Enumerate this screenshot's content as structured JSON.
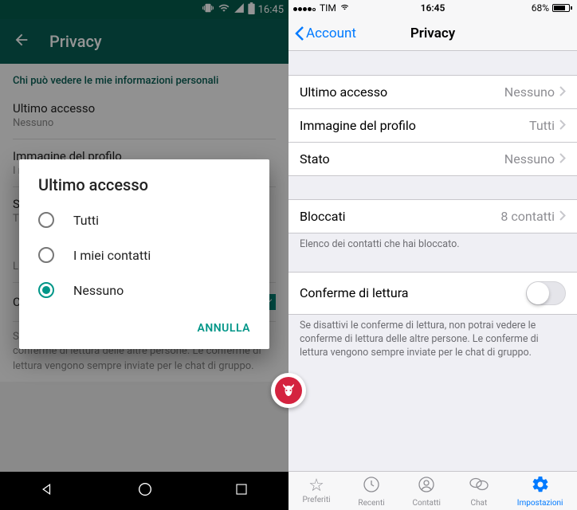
{
  "android": {
    "status": {
      "time": "16:45"
    },
    "toolbar": {
      "title": "Privacy"
    },
    "section_header": "Chi può vedere le mie informazioni personali",
    "items": [
      {
        "label": "Ultimo accesso",
        "value": "Nessuno"
      },
      {
        "label": "Immagine del profilo",
        "value": "I miei contatti"
      },
      {
        "label": "Stato",
        "value": "Tutti"
      }
    ],
    "blocked_caption": "Lista dei contatti che hai bloccato.",
    "read_receipts_label": "Conferme di lettura",
    "read_receipts_footer": "Se disattivi le conferme di lettura, non potrai vedere le conferme di lettura delle altre persone. Le conferme di lettura vengono sempre inviate per le chat di gruppo.",
    "dialog": {
      "title": "Ultimo accesso",
      "options": [
        "Tutti",
        "I miei contatti",
        "Nessuno"
      ],
      "selected_index": 2,
      "cancel": "ANNULLA"
    }
  },
  "ios": {
    "status": {
      "carrier": "TIM",
      "time": "16:45",
      "battery_pct": "68%"
    },
    "nav": {
      "back": "Account",
      "title": "Privacy"
    },
    "rows": {
      "last_seen": {
        "label": "Ultimo accesso",
        "value": "Nessuno"
      },
      "profile_photo": {
        "label": "Immagine del profilo",
        "value": "Tutti"
      },
      "status": {
        "label": "Stato",
        "value": "Nessuno"
      },
      "blocked": {
        "label": "Bloccati",
        "value": "8 contatti"
      },
      "blocked_caption": "Elenco dei contatti che hai bloccato.",
      "read_receipts": {
        "label": "Conferme di lettura"
      },
      "read_receipts_footer": "Se disattivi le conferme di lettura, non potrai vedere le conferme di lettura delle altre persone. Le conferme di lettura vengono sempre inviate per le chat di gruppo."
    },
    "tabs": [
      "Preferiti",
      "Recenti",
      "Contatti",
      "Chat",
      "Impostazioni"
    ],
    "active_tab_index": 4
  }
}
